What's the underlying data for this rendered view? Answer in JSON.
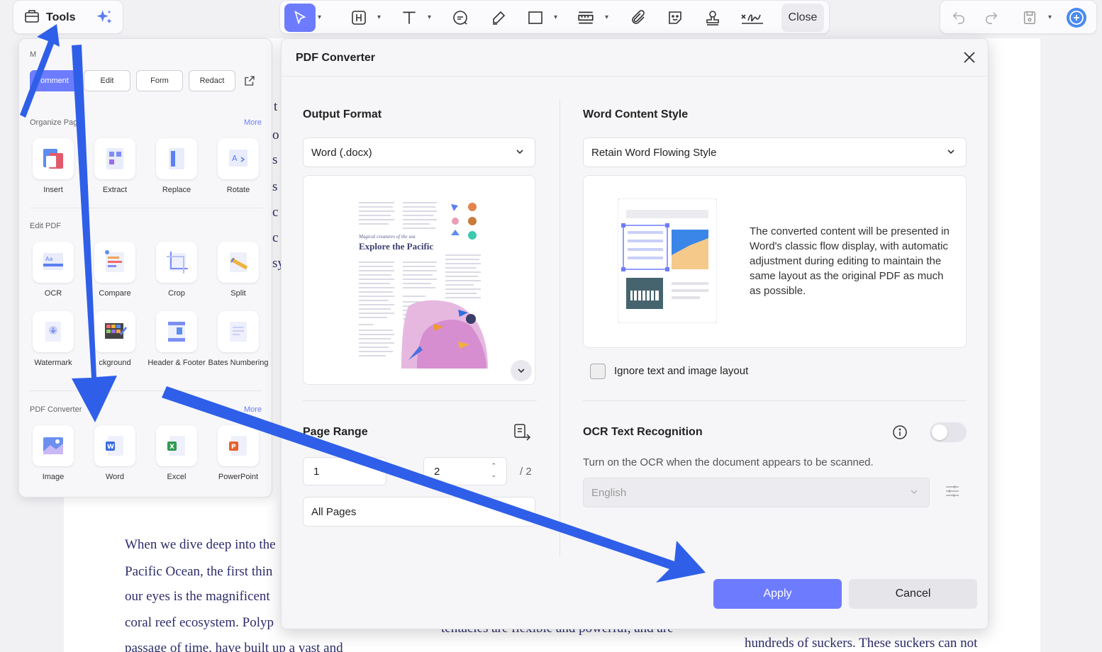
{
  "toolbar": {
    "tools_label": "Tools",
    "close_label": "Close"
  },
  "panel": {
    "mode_partial": "M",
    "tabs": [
      "omment",
      "Edit",
      "Form",
      "Redact"
    ],
    "organize_title": "Organize Pag",
    "organize_more": "More",
    "organize_items": [
      "Insert",
      "Extract",
      "Replace",
      "Rotate"
    ],
    "edit_title": "Edit PDF",
    "edit_items_row1": [
      "OCR",
      "Compare",
      "Crop",
      "Split"
    ],
    "edit_items_row2": [
      "Watermark",
      "ckground",
      "Header & Footer",
      "Bates Numbering"
    ],
    "converter_title": "PDF Converter",
    "converter_more": "More",
    "converter_items": [
      "Image",
      "Word",
      "Excel",
      "PowerPoint"
    ]
  },
  "dialog": {
    "title": "PDF Converter",
    "output_format_label": "Output Format",
    "output_format_value": "Word (.docx)",
    "preview": {
      "subtitle": "Magical creatures of the sea",
      "title": "Explore the Pacific"
    },
    "word_style_label": "Word Content Style",
    "word_style_value": "Retain Word Flowing Style",
    "style_description": "The converted content will be presented in Word's classic flow display, with automatic adjustment during editing to maintain the same layout as the original PDF as much as possible.",
    "ignore_layout_label": "Ignore text and image layout",
    "page_range_label": "Page Range",
    "page_from": "1",
    "page_to": "2",
    "page_total": "/ 2",
    "page_range_option": "All Pages",
    "ocr_label": "OCR Text Recognition",
    "ocr_hint": "Turn on the OCR when the document appears to be scanned.",
    "ocr_language": "English",
    "apply_label": "Apply",
    "cancel_label": "Cancel"
  },
  "document": {
    "lines_left": [
      "When we dive deep into the",
      "Pacific Ocean, the first thin",
      "our eyes is the magnificent",
      "coral reef ecosystem. Polyp",
      "passage of time, have built up a vast and"
    ],
    "line_middle": "tentacles are flexible and powerful, and are",
    "line_right": "hundreds of suckers. These suckers can not",
    "side_letters": [
      "t",
      "o",
      "s",
      "s",
      "c",
      "c",
      "sy"
    ]
  },
  "colors": {
    "accent": "#6d7cff",
    "arrow": "#2f5fe8",
    "doc_text": "#2d2d6b"
  }
}
